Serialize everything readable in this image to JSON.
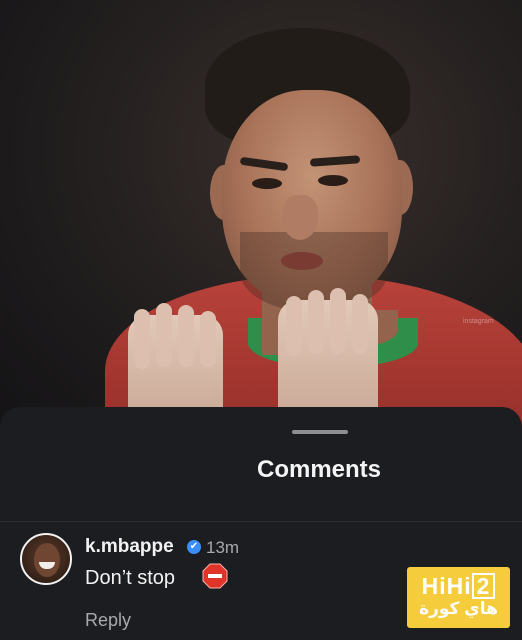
{
  "photo": {
    "watermark": "instagram"
  },
  "sheet": {
    "title": "Comments"
  },
  "comment": {
    "username": "k.mbappe",
    "verified_mark": "✔",
    "time": "13m",
    "text": "Don’t stop",
    "emoji": "stop-sign-icon",
    "reply_label": "Reply"
  },
  "logo": {
    "en_prefix": "HiHi",
    "en_suffix": "2",
    "ar": "هاي كورة"
  },
  "colors": {
    "sheet_bg": "#1c1d21",
    "verified": "#3a8ff7",
    "stop_sign": "#e0342a",
    "logo_bg": "#f5cc3c"
  }
}
